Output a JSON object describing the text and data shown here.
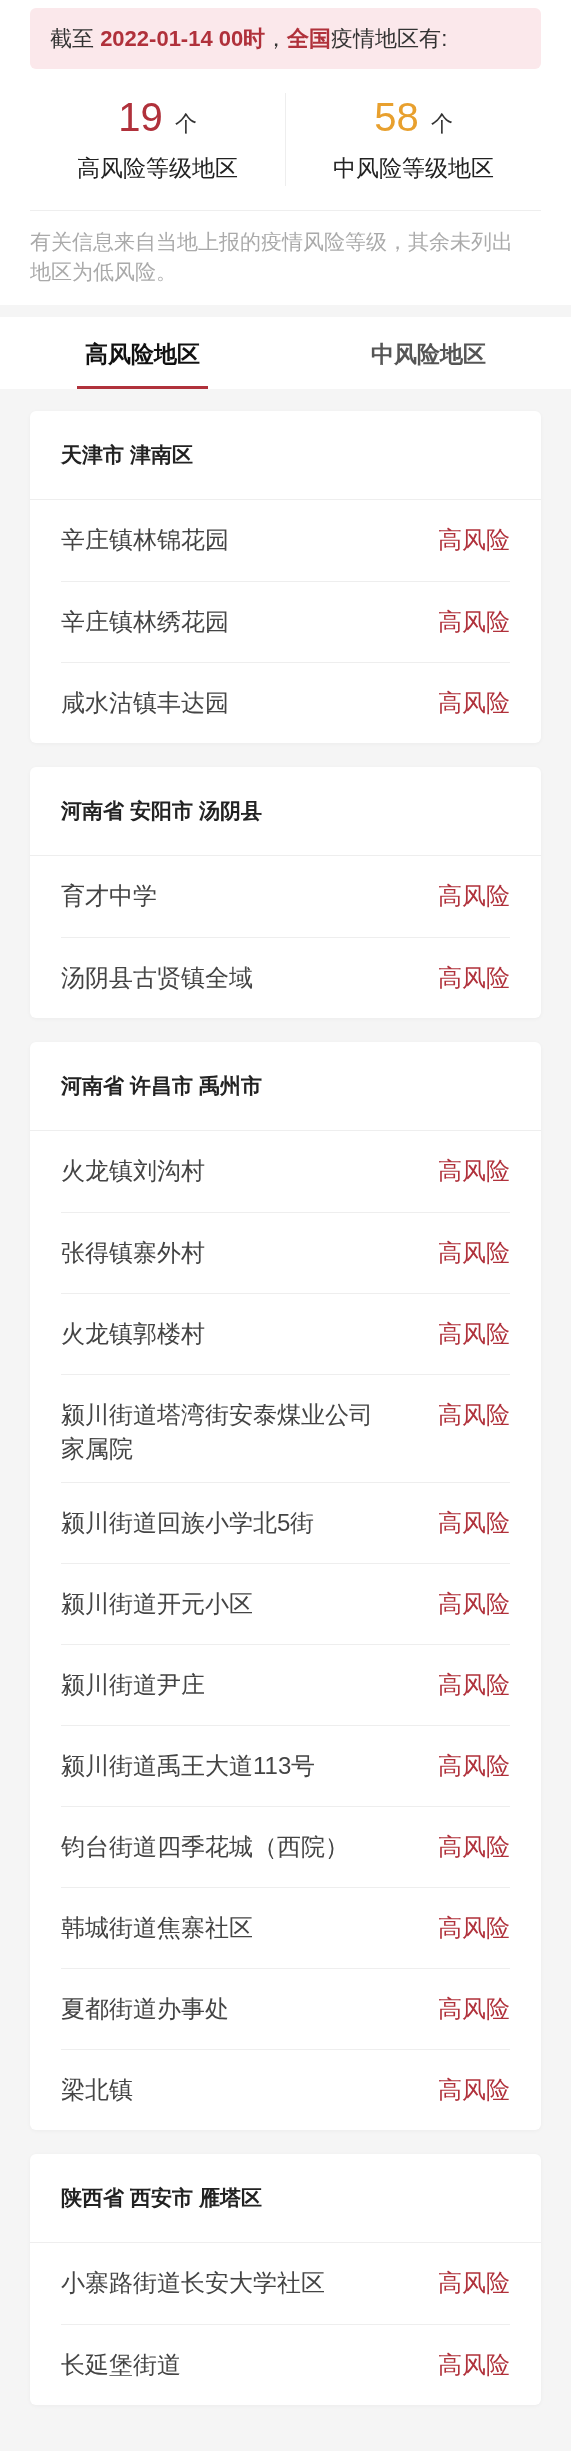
{
  "banner": "截至 **2022-01-14 00时**，**全国**疫情地区有:",
  "stats": [
    {
      "value": "19",
      "unit": "个",
      "label": "高风险等级地区",
      "color": "#b0313b"
    },
    {
      "value": "58",
      "unit": "个",
      "label": "中风险等级地区",
      "color": "#e8a02e"
    }
  ],
  "note": "有关信息来自当地上报的疫情风险等级，其余未列出地区为低风险。",
  "tabs": [
    {
      "label": "高风险地区",
      "selected": true
    },
    {
      "label": "中风险地区",
      "selected": false
    }
  ],
  "groups": [
    {
      "region": "天津市 津南区",
      "items": [
        {
          "name": "辛庄镇林锦花园",
          "risk": "高风险"
        },
        {
          "name": "辛庄镇林绣花园",
          "risk": "高风险"
        },
        {
          "name": "咸水沽镇丰达园",
          "risk": "高风险"
        }
      ]
    },
    {
      "region": "河南省 安阳市 汤阴县",
      "items": [
        {
          "name": "育才中学",
          "risk": "高风险"
        },
        {
          "name": "汤阴县古贤镇全域",
          "risk": "高风险"
        }
      ]
    },
    {
      "region": "河南省 许昌市 禹州市",
      "items": [
        {
          "name": "火龙镇刘沟村",
          "risk": "高风险"
        },
        {
          "name": "张得镇寨外村",
          "risk": "高风险"
        },
        {
          "name": "火龙镇郭楼村",
          "risk": "高风险"
        },
        {
          "name": "颍川街道塔湾街安泰煤业公司家属院",
          "risk": "高风险"
        },
        {
          "name": "颍川街道回族小学北5街",
          "risk": "高风险"
        },
        {
          "name": "颍川街道开元小区",
          "risk": "高风险"
        },
        {
          "name": "颍川街道尹庄",
          "risk": "高风险"
        },
        {
          "name": "颍川街道禹王大道113号",
          "risk": "高风险"
        },
        {
          "name": "钧台街道四季花城（西院）",
          "risk": "高风险"
        },
        {
          "name": "韩城街道焦寨社区",
          "risk": "高风险"
        },
        {
          "name": "夏都街道办事处",
          "risk": "高风险"
        },
        {
          "name": "梁北镇",
          "risk": "高风险"
        }
      ]
    },
    {
      "region": "陕西省 西安市 雁塔区",
      "items": [
        {
          "name": "小寨路街道长安大学社区",
          "risk": "高风险"
        },
        {
          "name": "长延堡街道",
          "risk": "高风险"
        }
      ]
    }
  ]
}
